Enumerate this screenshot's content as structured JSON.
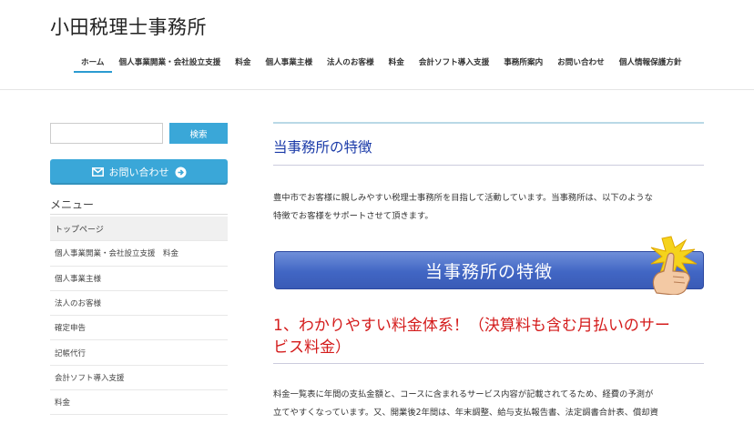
{
  "site": {
    "title": "小田税理士事務所"
  },
  "nav": {
    "items": [
      "ホーム",
      "個人事業開業・会社設立支援",
      "料金",
      "個人事業主様",
      "法人のお客様",
      "料金",
      "会計ソフト導入支援",
      "事務所案内",
      "お問い合わせ",
      "個人情報保護方針"
    ],
    "active_index": 0
  },
  "sidebar": {
    "search": {
      "value": "",
      "button_label": "検索"
    },
    "contact_button_label": "お問い合わせ",
    "menu_heading": "メニュー",
    "menu_items": [
      "トップページ",
      "個人事業開業・会社設立支援　料金",
      "個人事業主様",
      "法人のお客様",
      "確定申告",
      "記帳代行",
      "会計ソフト導入支援",
      "料金"
    ]
  },
  "main": {
    "section_title": "当事務所の特徴",
    "intro_line1": "豊中市でお客様に親しみやすい税理士事務所を目指して活動しています。当事務所は、以下のような",
    "intro_line2": "特徴でお客様をサポートさせて頂きます。",
    "banner_text": "当事務所の特徴",
    "point_heading_line1": "1、わかりやすい料金体系！（決算料も含む月払いのサー",
    "point_heading_line2": "ビス料金）",
    "point_line1": "料金一覧表に年間の支払金額と、コースに含まれるサービス内容が記載されてるため、経費の予測が",
    "point_line2": "立てやすくなっています。又、開業後2年間は、年末調整、給与支払報告書、法定調書合計表、償却資"
  },
  "colors": {
    "accent": "#3aa7d8",
    "title_blue": "#1a3aa8",
    "heading_red": "#d41c1c",
    "banner_blue": "#4166c4"
  }
}
